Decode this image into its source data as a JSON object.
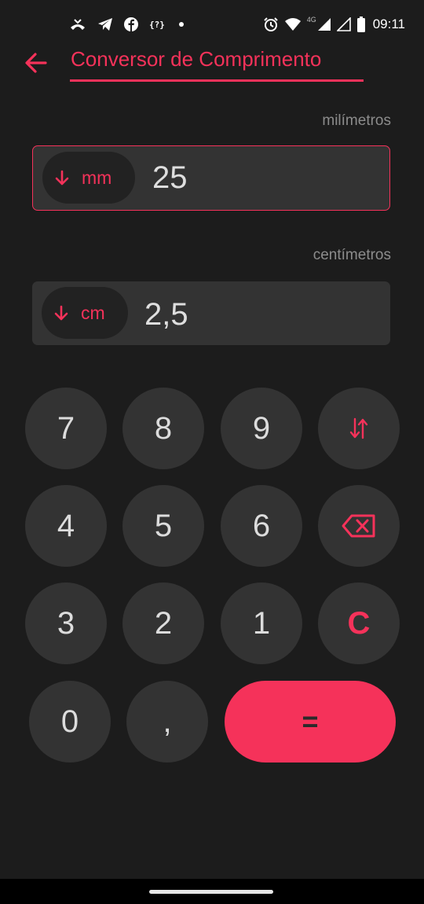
{
  "status_bar": {
    "time": "09:11",
    "network": "4G",
    "notification_icons": [
      "missed-call-icon",
      "telegram-icon",
      "facebook-icon",
      "braces-icon",
      "dot-icon"
    ],
    "system_icons": [
      "alarm-icon",
      "wifi-icon",
      "signal-icon",
      "signal-icon",
      "battery-icon"
    ],
    "braces_text": "{?}"
  },
  "header": {
    "title": "Conversor de Comprimento",
    "back_icon": "arrow-left-icon"
  },
  "fields": [
    {
      "label": "milímetros",
      "unit": "mm",
      "value": "25",
      "active": true
    },
    {
      "label": "centímetros",
      "unit": "cm",
      "value": "2,5",
      "active": false
    }
  ],
  "keypad": {
    "rows": [
      [
        "7",
        "8",
        "9",
        "swap"
      ],
      [
        "4",
        "5",
        "6",
        "backspace"
      ],
      [
        "3",
        "2",
        "1",
        "C"
      ],
      [
        "0",
        ",",
        "="
      ]
    ],
    "labels": {
      "k7": "7",
      "k8": "8",
      "k9": "9",
      "k4": "4",
      "k5": "5",
      "k6": "6",
      "k3": "3",
      "k2": "2",
      "k1": "1",
      "clear": "C",
      "k0": "0",
      "comma": ",",
      "equals": "="
    }
  },
  "colors": {
    "accent": "#f5325a",
    "background": "#1c1c1c",
    "surface": "#333333",
    "text": "#dcdcdc",
    "muted": "#8c8c8c"
  }
}
